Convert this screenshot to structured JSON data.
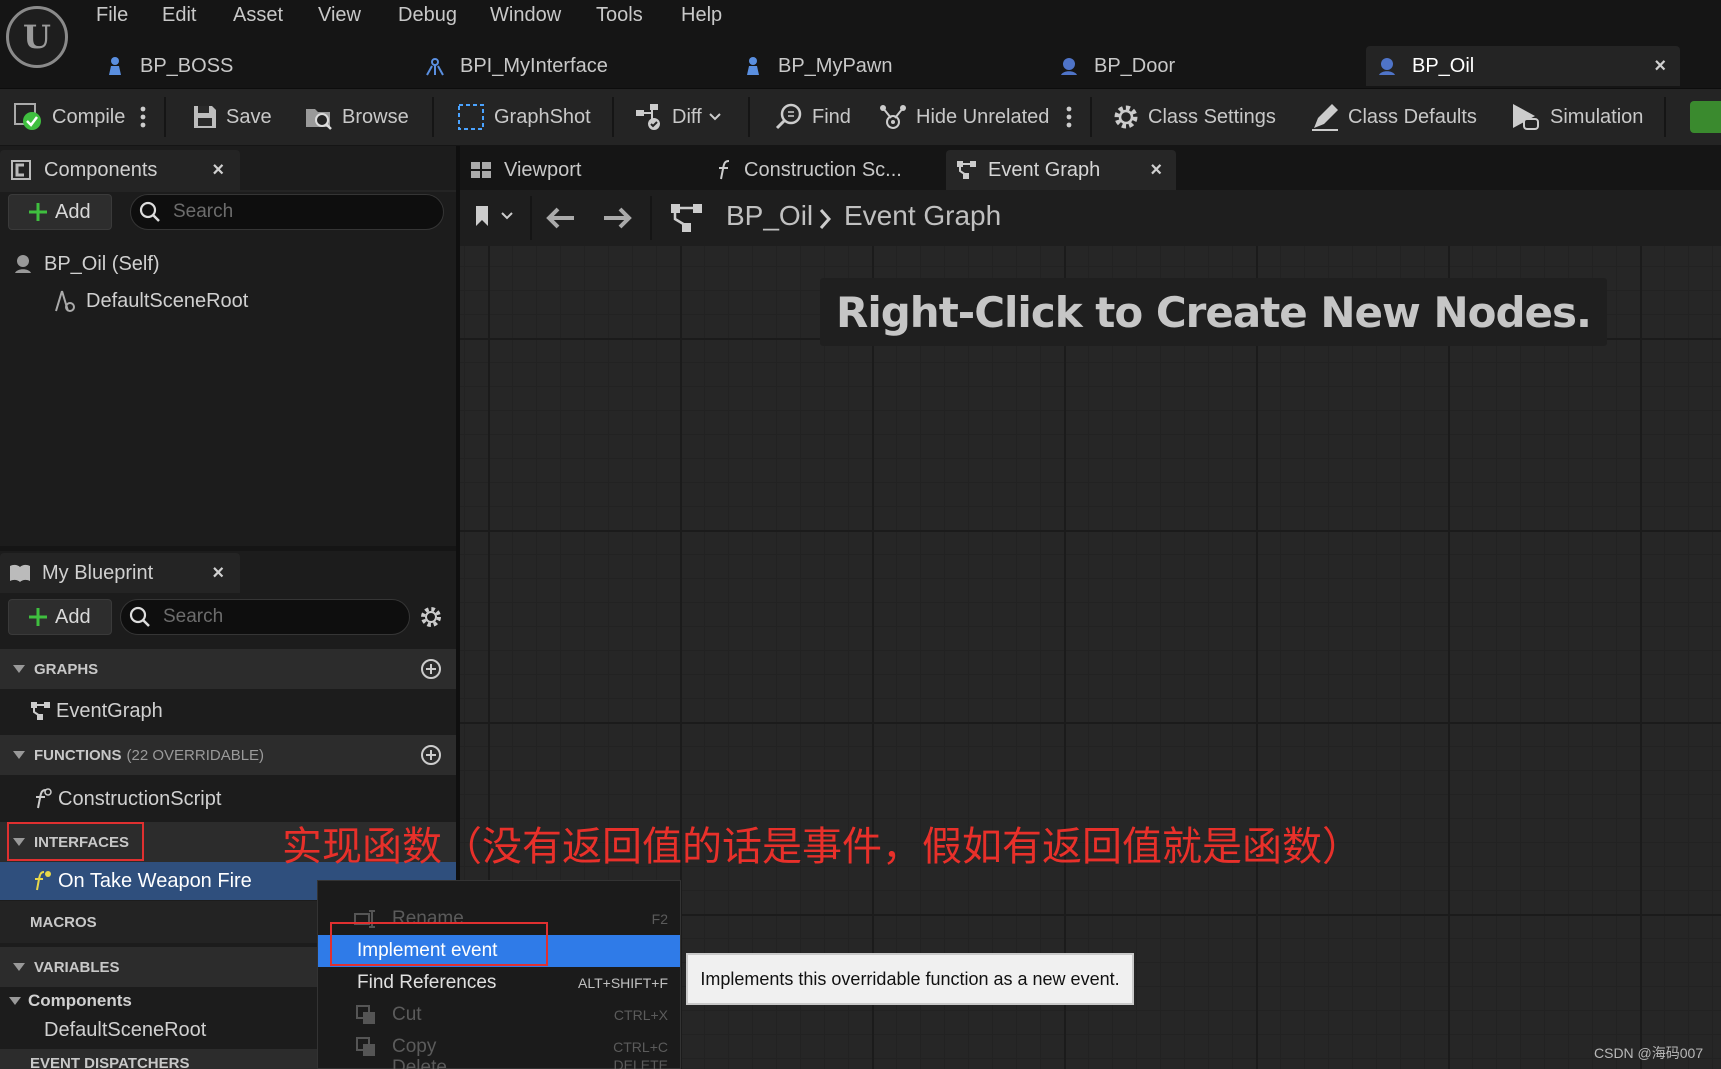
{
  "menu": [
    "File",
    "Edit",
    "Asset",
    "View",
    "Debug",
    "Window",
    "Tools",
    "Help"
  ],
  "doc_tabs": [
    {
      "label": "BP_BOSS"
    },
    {
      "label": "BPI_MyInterface"
    },
    {
      "label": "BP_MyPawn"
    },
    {
      "label": "BP_Door"
    },
    {
      "label": "BP_Oil",
      "active": true
    }
  ],
  "close_glyph": "×",
  "toolbar": {
    "compile": "Compile",
    "save": "Save",
    "browse": "Browse",
    "graphshot": "GraphShot",
    "diff": "Diff",
    "find": "Find",
    "hide_unrelated": "Hide Unrelated",
    "class_settings": "Class Settings",
    "class_defaults": "Class Defaults",
    "simulation": "Simulation"
  },
  "components_panel": {
    "title": "Components",
    "add": "Add",
    "search_placeholder": "Search",
    "tree": [
      "BP_Oil (Self)",
      "DefaultSceneRoot"
    ]
  },
  "my_blueprint": {
    "title": "My Blueprint",
    "add": "Add",
    "search_placeholder": "Search",
    "graphs_header": "GRAPHS",
    "event_graph": "EventGraph",
    "functions_header": "FUNCTIONS",
    "functions_suffix": "(22 OVERRIDABLE)",
    "construction_script": "ConstructionScript",
    "interfaces_header": "INTERFACES",
    "interface_item": "On Take Weapon Fire",
    "macros_header": "MACROS",
    "variables_header": "VARIABLES",
    "var_group": "Components",
    "var_item": "DefaultSceneRoot",
    "dispatchers_header": "EVENT DISPATCHERS"
  },
  "graph_tabs": [
    "Viewport",
    "Construction Sc...",
    "Event Graph"
  ],
  "breadcrumb": {
    "blueprint": "BP_Oil",
    "graph": "Event Graph"
  },
  "graph_hint": "Right-Click to Create New Nodes.",
  "context_menu": [
    {
      "label": "Rename",
      "shortcut": "F2",
      "enabled": false
    },
    {
      "label": "Implement event",
      "shortcut": "",
      "enabled": true,
      "highlighted": true
    },
    {
      "label": "Find References",
      "shortcut": "ALT+SHIFT+F",
      "enabled": true
    },
    {
      "label": "Cut",
      "shortcut": "CTRL+X",
      "enabled": false
    },
    {
      "label": "Copy",
      "shortcut": "CTRL+C",
      "enabled": false
    },
    {
      "label": "Delete",
      "shortcut": "DELETE",
      "enabled": false
    }
  ],
  "tooltip": "Implements this overridable function as a new event.",
  "annotation": "实现函数（没有返回值的话是事件，假如有返回值就是函数）",
  "watermark": "CSDN @海码007",
  "colors": {
    "accent": "#2f7be8",
    "annotation": "#e03030",
    "compile_ok": "#3fbf3f"
  }
}
